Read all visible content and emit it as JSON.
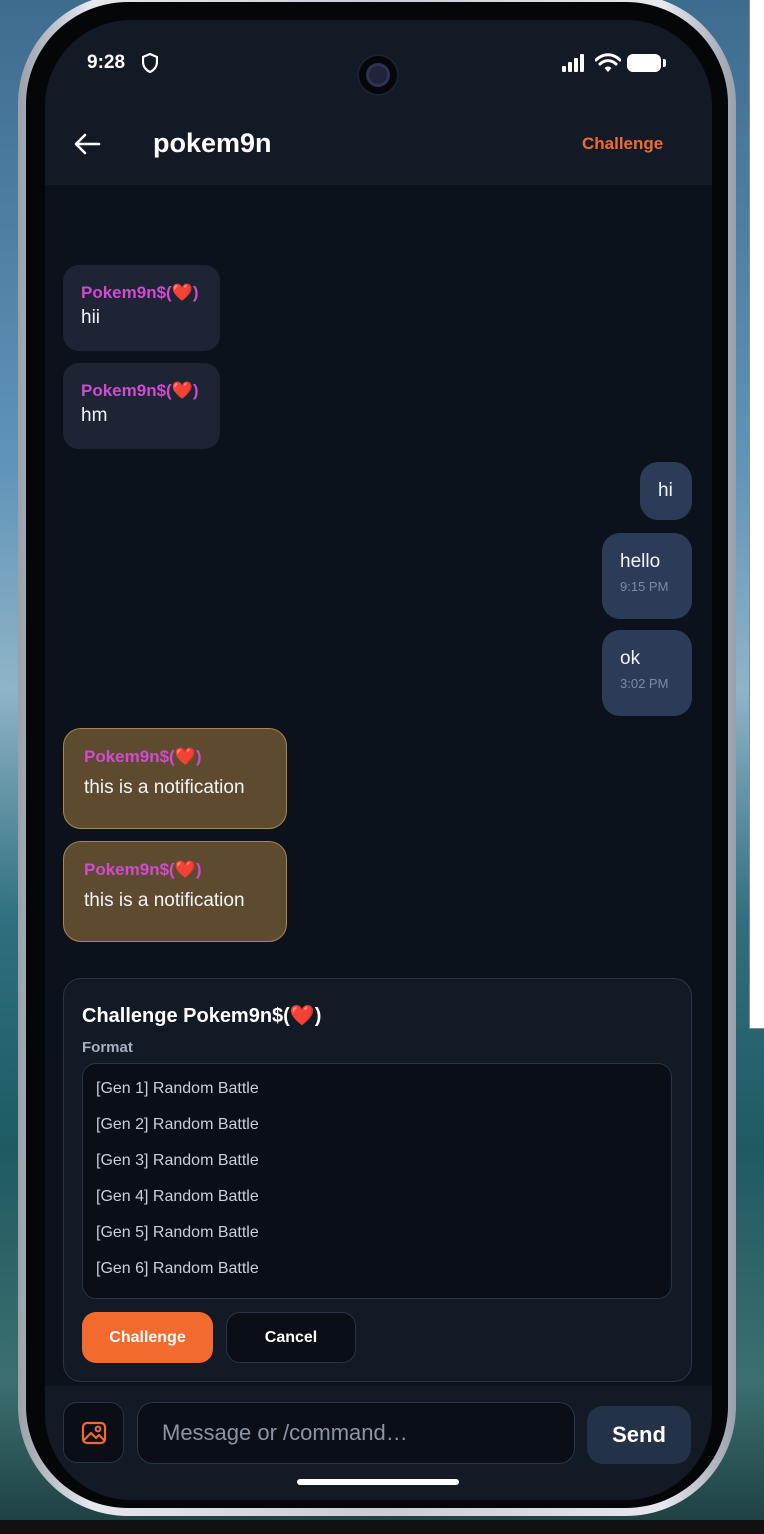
{
  "status": {
    "time": "9:28"
  },
  "header": {
    "title": "pokem9n",
    "challenge_label": "Challenge"
  },
  "messages": [
    {
      "sender": "Pokem9n$(❤️)",
      "text": "hii"
    },
    {
      "sender": "Pokem9n$(❤️)",
      "text": "hm"
    },
    {
      "text": "hi"
    },
    {
      "text": "hello",
      "time": "9:15 PM"
    },
    {
      "text": "ok",
      "time": "3:02 PM"
    }
  ],
  "notifications": [
    {
      "sender": "Pokem9n$(❤️)",
      "text": "this is a notification"
    },
    {
      "sender": "Pokem9n$(❤️)",
      "text": "this is a notification"
    }
  ],
  "challenge_panel": {
    "title": "Challenge Pokem9n$(❤️)",
    "format_label": "Format",
    "formats": [
      "[Gen 1] Random Battle",
      "[Gen 2] Random Battle",
      "[Gen 3] Random Battle",
      "[Gen 4] Random Battle",
      "[Gen 5] Random Battle",
      "[Gen 6] Random Battle"
    ],
    "challenge_button": "Challenge",
    "cancel_button": "Cancel"
  },
  "composer": {
    "placeholder": "Message or /command…",
    "send_label": "Send"
  },
  "colors": {
    "accent": "#f26a2e",
    "sender": "#cf4bcf",
    "notification_bg": "#5e4b2f"
  }
}
